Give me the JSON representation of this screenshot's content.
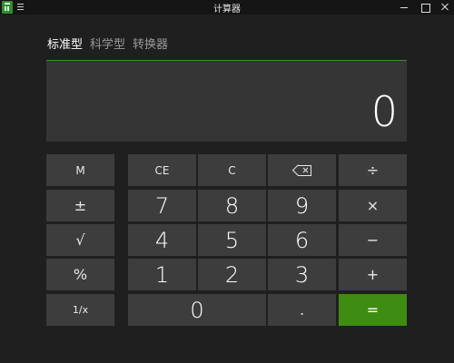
{
  "window": {
    "title": "计算器",
    "icons": {
      "app": "calculator-icon",
      "menu": "hamburger-icon",
      "minimize": "minimize-icon",
      "maximize": "maximize-icon",
      "close": "close-icon"
    }
  },
  "modes": {
    "standard": "标准型",
    "scientific": "科学型",
    "converter": "转换器",
    "active": "标准型"
  },
  "display": {
    "value": "0"
  },
  "colors": {
    "accent": "#3f8c12",
    "background": "#1f1f1f",
    "key": "#3d3d3d",
    "display": "#353535"
  },
  "keys": {
    "memory": "M",
    "negate": "±",
    "sqrt": "√",
    "percent": "%",
    "reciprocal": "1/x",
    "ce": "CE",
    "c": "C",
    "backspace_icon": "backspace-icon",
    "divide": "÷",
    "multiply": "×",
    "minus": "−",
    "plus": "+",
    "equals": "=",
    "dot": ".",
    "n0": "0",
    "n1": "1",
    "n2": "2",
    "n3": "3",
    "n4": "4",
    "n5": "5",
    "n6": "6",
    "n7": "7",
    "n8": "8",
    "n9": "9"
  }
}
